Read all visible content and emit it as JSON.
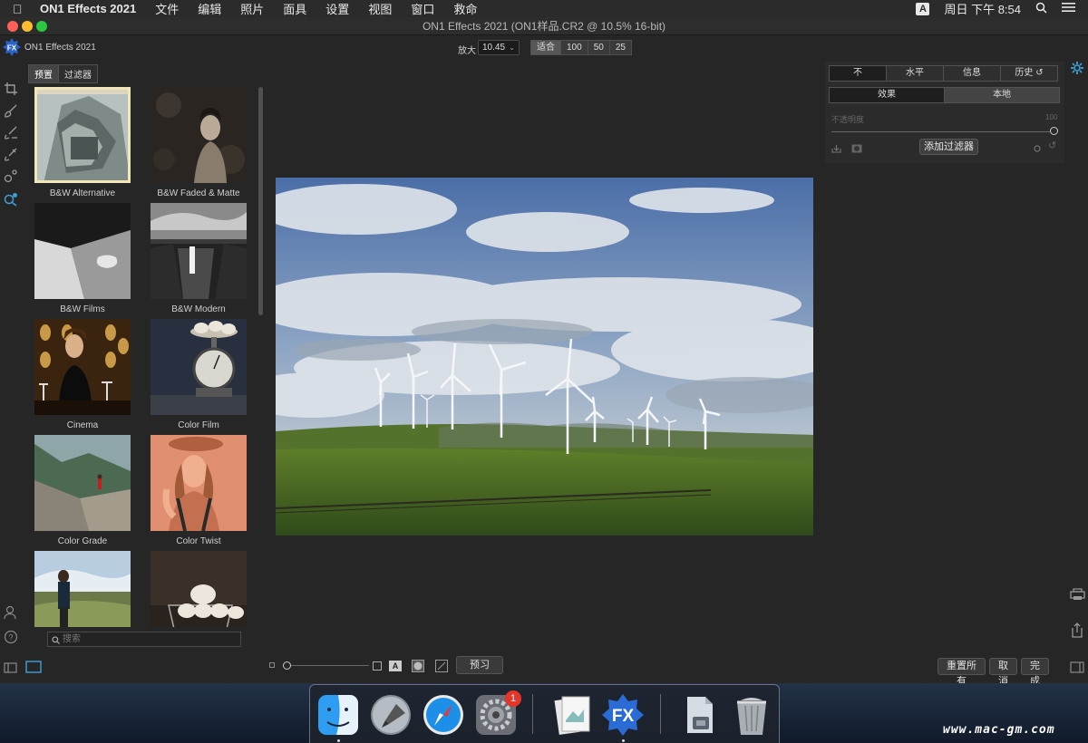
{
  "menubar": {
    "app_name": "ON1 Effects 2021",
    "menus": [
      "文件",
      "编辑",
      "照片",
      "面具",
      "设置",
      "视图",
      "窗口",
      "救命"
    ],
    "input_method": "A",
    "clock": "周日 下午 8:54"
  },
  "window": {
    "title": "ON1 Effects 2021 (ON1样品.CR2 @ 10.5% 16-bit)"
  },
  "toolbar": {
    "app_title": "ON1 Effects 2021",
    "zoom_label": "放大",
    "zoom_value": "10.45",
    "zoom_buttons": [
      "适合",
      "100",
      "50",
      "25"
    ]
  },
  "browser": {
    "tabs": [
      "预置",
      "过滤器"
    ],
    "presets": [
      {
        "name": "B&W Alternative",
        "selected": true
      },
      {
        "name": "B&W Faded & Matte"
      },
      {
        "name": "B&W Films"
      },
      {
        "name": "B&W Modern"
      },
      {
        "name": "Cinema"
      },
      {
        "name": "Color Film"
      },
      {
        "name": "Color Grade"
      },
      {
        "name": "Color Twist"
      },
      {
        "name": ""
      },
      {
        "name": ""
      }
    ],
    "search_placeholder": "搜索"
  },
  "bottom": {
    "preview_label": "预习",
    "reset_all_label": "重置所有",
    "cancel_label": "取消",
    "done_label": "完成",
    "text_toggle": "A"
  },
  "right_panel": {
    "tabs": [
      "不",
      "水平",
      "信息",
      "历史"
    ],
    "sub_tabs": [
      "效果",
      "本地"
    ],
    "opacity_label": "不透明度",
    "opacity_value": "100",
    "add_filter_label": "添加过滤器"
  },
  "dock": {
    "apps": [
      "finder",
      "launchpad",
      "safari",
      "system-preferences",
      "preview",
      "on1-effects",
      "file-archive",
      "trash"
    ],
    "badge": "1"
  },
  "watermark": "www.mac-gm.com"
}
